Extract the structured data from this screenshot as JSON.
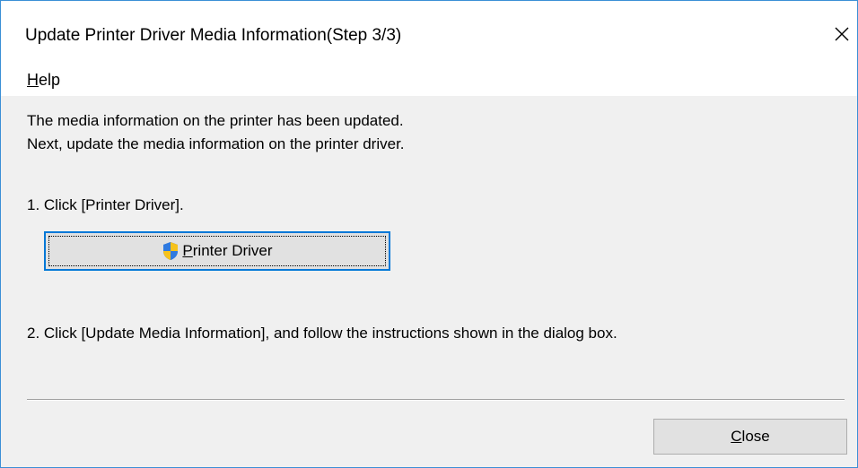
{
  "window": {
    "title": "Update Printer Driver Media Information(Step 3/3)"
  },
  "menu": {
    "help_mnemonic": "H",
    "help_rest": "elp"
  },
  "content": {
    "intro_line1": "The media information on the printer has been updated.",
    "intro_line2": "Next, update the media information on the printer driver.",
    "step1": "1. Click [Printer Driver].",
    "step2": "2. Click [Update Media Information], and follow the instructions shown in the dialog box."
  },
  "buttons": {
    "printer_driver_mnemonic": "P",
    "printer_driver_rest": "rinter Driver",
    "close_mnemonic": "C",
    "close_rest": "lose"
  },
  "icons": {
    "titlebar_close": "close-icon",
    "uac_shield": "uac-shield-icon"
  },
  "colors": {
    "window_border": "#3b8fd6",
    "focus_border": "#0078d7",
    "dialog_background": "#f0f0f0",
    "button_face": "#e1e1e1"
  }
}
